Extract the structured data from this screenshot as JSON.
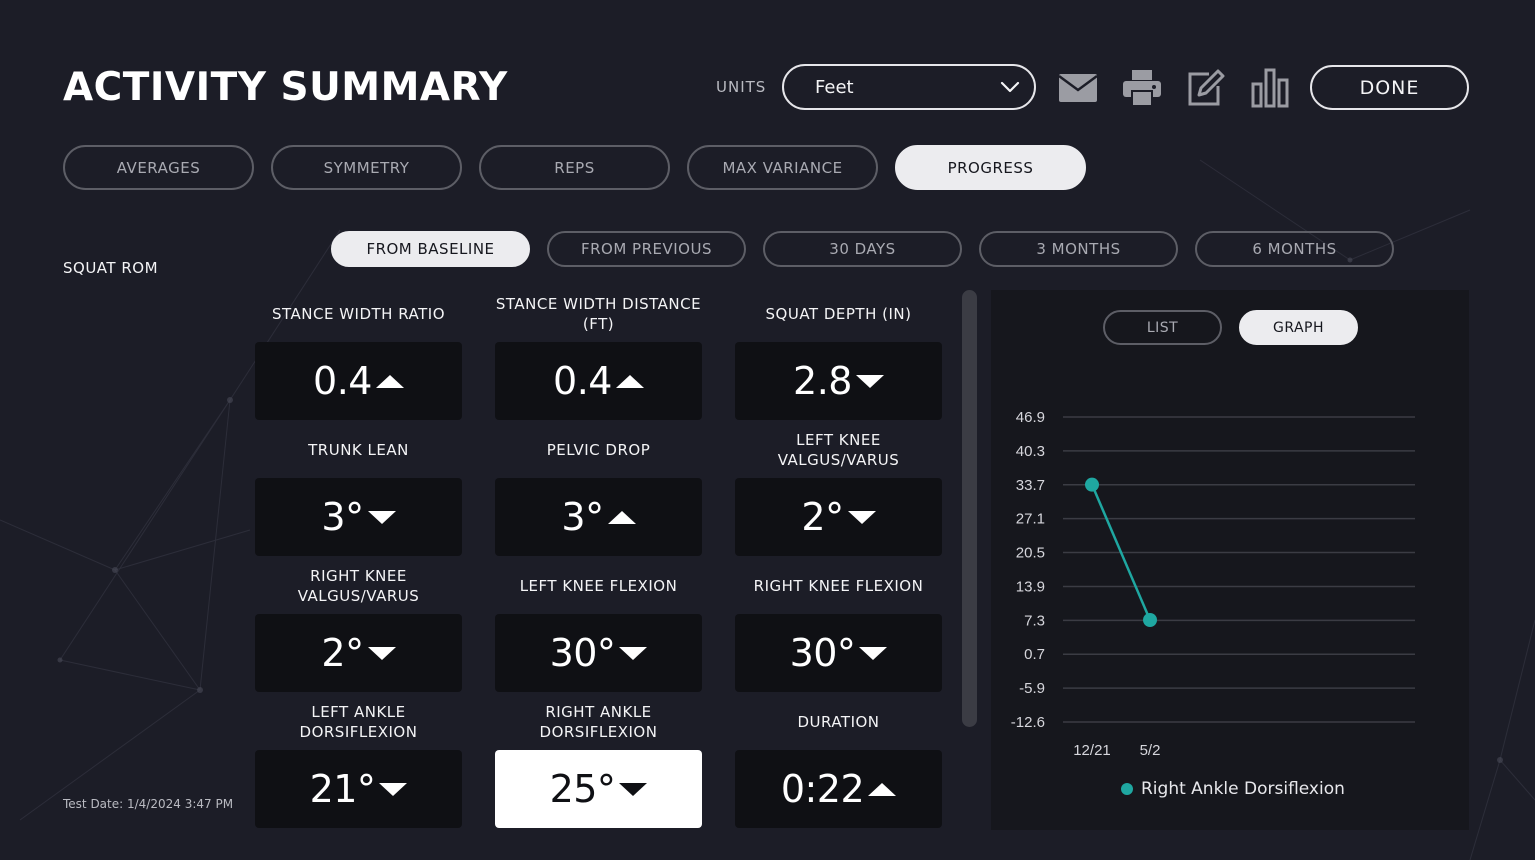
{
  "header": {
    "title": "ACTIVITY SUMMARY",
    "units_label": "UNITS",
    "units_value": "Feet",
    "done_label": "DONE",
    "icons": [
      "mail-icon",
      "printer-icon",
      "edit-icon",
      "bar-chart-icon"
    ]
  },
  "tabs": [
    {
      "label": "AVERAGES",
      "active": false
    },
    {
      "label": "SYMMETRY",
      "active": false
    },
    {
      "label": "REPS",
      "active": false
    },
    {
      "label": "MAX VARIANCE",
      "active": false
    },
    {
      "label": "PROGRESS",
      "active": true
    }
  ],
  "subtabs": [
    {
      "label": "FROM BASELINE",
      "active": true
    },
    {
      "label": "FROM PREVIOUS",
      "active": false
    },
    {
      "label": "30 DAYS",
      "active": false
    },
    {
      "label": "3 MONTHS",
      "active": false
    },
    {
      "label": "6 MONTHS",
      "active": false
    }
  ],
  "section_label": "SQUAT ROM",
  "test_date": "Test Date: 1/4/2024 3:47 PM",
  "metrics": [
    {
      "label": "STANCE WIDTH RATIO",
      "value": "0.4",
      "trend": "up"
    },
    {
      "label": "STANCE WIDTH DISTANCE (FT)",
      "value": "0.4",
      "trend": "up"
    },
    {
      "label": "SQUAT DEPTH (IN)",
      "value": "2.8",
      "trend": "down"
    },
    {
      "label": "TRUNK LEAN",
      "value": "3°",
      "trend": "down"
    },
    {
      "label": "PELVIC DROP",
      "value": "3°",
      "trend": "up"
    },
    {
      "label": "LEFT KNEE VALGUS/VARUS",
      "value": "2°",
      "trend": "down"
    },
    {
      "label": "RIGHT KNEE VALGUS/VARUS",
      "value": "2°",
      "trend": "down"
    },
    {
      "label": "LEFT KNEE FLEXION",
      "value": "30°",
      "trend": "down"
    },
    {
      "label": "RIGHT KNEE FLEXION",
      "value": "30°",
      "trend": "down"
    },
    {
      "label": "LEFT ANKLE DORSIFLEXION",
      "value": "21°",
      "trend": "down"
    },
    {
      "label": "RIGHT ANKLE DORSIFLEXION",
      "value": "25°",
      "trend": "down",
      "selected": true
    },
    {
      "label": "DURATION",
      "value": "0:22",
      "trend": "up"
    }
  ],
  "graph_view": {
    "list_label": "LIST",
    "graph_label": "GRAPH",
    "active": "GRAPH"
  },
  "colors": {
    "background": "#1c1d27",
    "panel": "#16171d",
    "card": "#0f1014",
    "accent": "#1fa7a1",
    "active_pill": "#ececef"
  },
  "chart_data": {
    "type": "line",
    "x": [
      "12/21",
      "5/2"
    ],
    "series": [
      {
        "name": "Right Ankle Dorsiflexion",
        "values": [
          33.7,
          7.3
        ],
        "color": "#1fa7a1"
      }
    ],
    "y_ticks": [
      "46.9",
      "40.3",
      "33.7",
      "27.1",
      "20.5",
      "13.9",
      "7.3",
      "0.7",
      "-5.9",
      "-12.6"
    ],
    "ylim": [
      -12.6,
      46.9
    ],
    "grid": true,
    "legend": "bottom-center",
    "title": "",
    "xlabel": "",
    "ylabel": ""
  }
}
